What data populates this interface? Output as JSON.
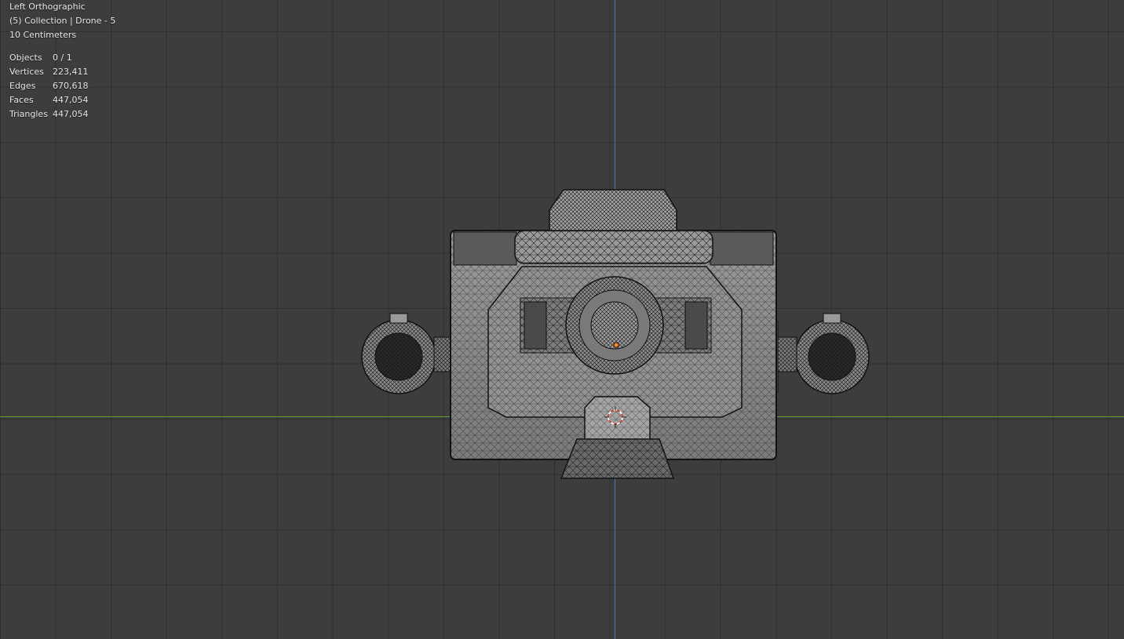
{
  "viewport": {
    "view_name": "Left Orthographic",
    "collection_info": "(5) Collection | Drone - 5",
    "grid_scale": "10 Centimeters",
    "colors": {
      "background": "#3d3d3d",
      "grid_line": "#333333",
      "axis_z": "#4a78b8",
      "axis_y": "#6f9a36",
      "mesh_fill": "#8a8a8a",
      "wire": "#1a1a1a",
      "origin": "#ff8c1a",
      "cursor": "#d04040"
    }
  },
  "stats": [
    {
      "label": "Objects",
      "value": "0 / 1"
    },
    {
      "label": "Vertices",
      "value": "223,411"
    },
    {
      "label": "Edges",
      "value": "670,618"
    },
    {
      "label": "Faces",
      "value": "447,054"
    },
    {
      "label": "Triangles",
      "value": "447,054"
    }
  ],
  "icons": {
    "cursor": "3d-cursor-icon",
    "origin": "object-origin-icon"
  }
}
